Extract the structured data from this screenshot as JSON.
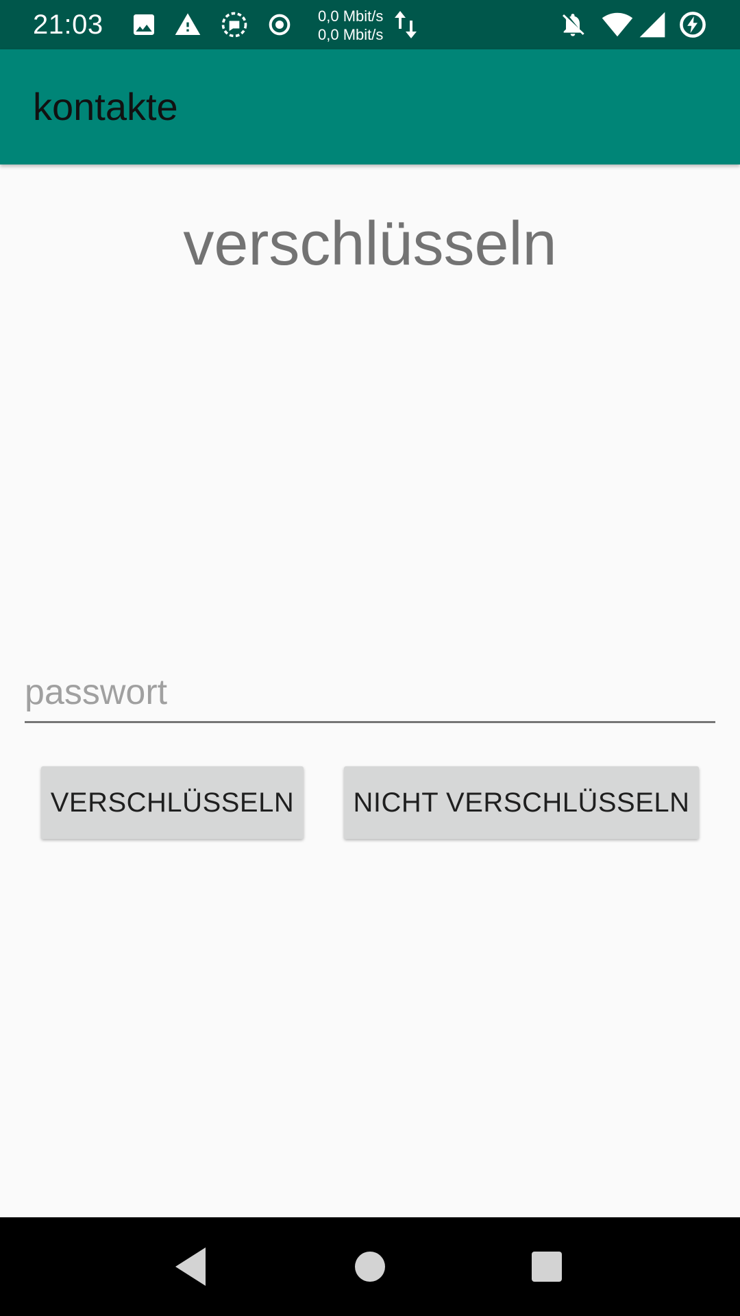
{
  "status_bar": {
    "time": "21:03",
    "net_up": "0,0 Mbit/s",
    "net_down": "0,0 Mbit/s",
    "icons": [
      "image-icon",
      "warning-icon",
      "sync-chat-icon",
      "record-icon",
      "data-arrows-icon",
      "notifications-off-icon",
      "wifi-icon",
      "cell-signal-icon",
      "battery-charging-icon"
    ]
  },
  "app_bar": {
    "title": "kontakte"
  },
  "main": {
    "heading": "verschlüsseln",
    "password": {
      "value": "",
      "placeholder": "passwort"
    },
    "buttons": {
      "encrypt_label": "VERSCHLÜSSELN",
      "no_encrypt_label": "NICHT VERSCHLÜSSELN"
    }
  },
  "nav_bar": {
    "icons": [
      "back-icon",
      "home-icon",
      "recents-icon"
    ]
  },
  "colors": {
    "status_bar": "#00574B",
    "app_bar": "#008577",
    "background": "#FAFAFA",
    "button": "#D6D7D7"
  }
}
